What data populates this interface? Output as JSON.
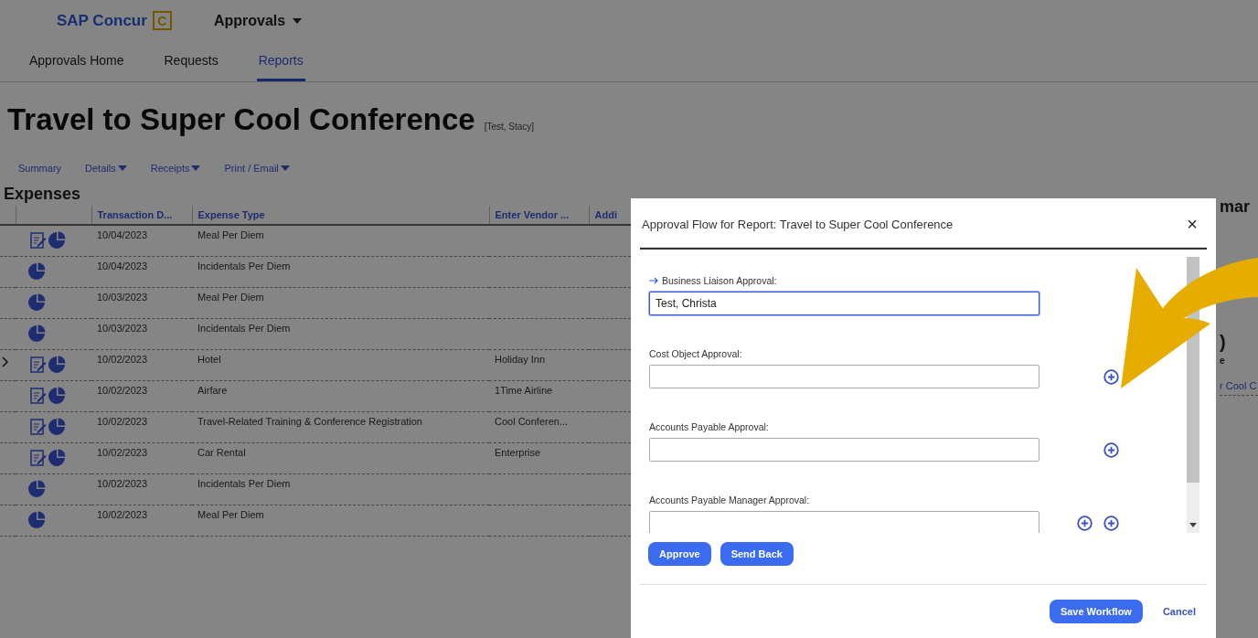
{
  "header": {
    "brand": "SAP Concur",
    "brand_mark": "C",
    "module": "Approvals"
  },
  "nav_tabs": [
    {
      "label": "Approvals Home",
      "selected": false
    },
    {
      "label": "Requests",
      "selected": false
    },
    {
      "label": "Reports",
      "selected": true
    }
  ],
  "report": {
    "title": "Travel to Super Cool Conference",
    "owner": "[Test, Stacy]"
  },
  "report_menu": [
    {
      "label": "Summary",
      "dropdown": false
    },
    {
      "label": "Details",
      "dropdown": true
    },
    {
      "label": "Receipts",
      "dropdown": true
    },
    {
      "label": "Print / Email",
      "dropdown": true
    }
  ],
  "expenses": {
    "heading": "Expenses",
    "columns": [
      "Transaction D...",
      "Expense Type",
      "Enter Vendor ...",
      "Addi"
    ],
    "rows": [
      {
        "selected": false,
        "receipt": true,
        "date": "10/04/2023",
        "type": "Meal Per Diem",
        "vendor": ""
      },
      {
        "selected": false,
        "receipt": false,
        "date": "10/04/2023",
        "type": "Incidentals Per Diem",
        "vendor": ""
      },
      {
        "selected": false,
        "receipt": false,
        "date": "10/03/2023",
        "type": "Meal Per Diem",
        "vendor": ""
      },
      {
        "selected": false,
        "receipt": false,
        "date": "10/03/2023",
        "type": "Incidentals Per Diem",
        "vendor": ""
      },
      {
        "selected": true,
        "receipt": true,
        "date": "10/02/2023",
        "type": "Hotel",
        "vendor": "Holiday Inn"
      },
      {
        "selected": false,
        "receipt": true,
        "date": "10/02/2023",
        "type": "Airfare",
        "vendor": "1Time Airline"
      },
      {
        "selected": false,
        "receipt": true,
        "date": "10/02/2023",
        "type": "Travel-Related Training & Conference Registration",
        "vendor": "Cool Conferen..."
      },
      {
        "selected": false,
        "receipt": true,
        "date": "10/02/2023",
        "type": "Car Rental",
        "vendor": "Enterprise"
      },
      {
        "selected": false,
        "receipt": false,
        "date": "10/02/2023",
        "type": "Incidentals Per Diem",
        "vendor": ""
      },
      {
        "selected": false,
        "receipt": false,
        "date": "10/02/2023",
        "type": "Meal Per Diem",
        "vendor": ""
      }
    ]
  },
  "summary_fragments": {
    "heading": "mar",
    "amount": ")",
    "caption": "e",
    "link": "r Cool C"
  },
  "dialog": {
    "title": "Approval Flow for Report: Travel to Super Cool Conference",
    "close": "×",
    "steps": [
      {
        "label": "Business Liaison Approval:",
        "value": "Test, Christa",
        "current": true,
        "add_before": false,
        "add_after": false
      },
      {
        "label": "Cost Object Approval:",
        "current": false,
        "add_before": false,
        "add_after": true
      },
      {
        "label": "Accounts Payable Approval:",
        "current": false,
        "add_before": false,
        "add_after": true
      },
      {
        "label": "Accounts Payable Manager Approval:",
        "current": false,
        "add_before": true,
        "add_after": true
      }
    ],
    "actions": [
      "Approve",
      "Send Back"
    ],
    "save": "Save Workflow",
    "cancel": "Cancel"
  }
}
